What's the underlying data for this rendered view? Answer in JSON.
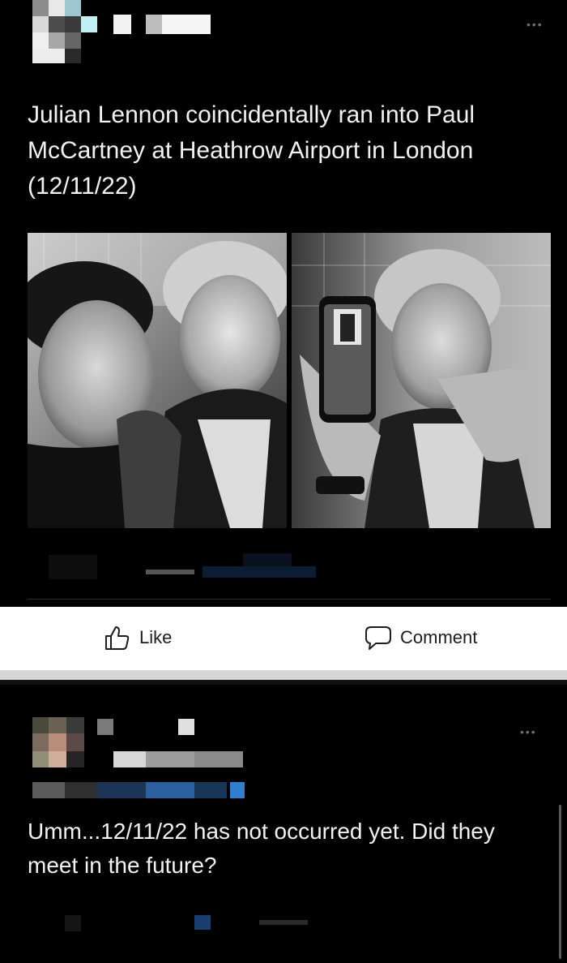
{
  "post": {
    "text": "Julian Lennon coincidentally ran into Paul McCartney at Heathrow Airport in London (12/11/22)",
    "more_icon": "more-horizontal-icon"
  },
  "photos": [
    {
      "description_icon": "photo-left"
    },
    {
      "description_icon": "photo-right"
    }
  ],
  "actions": {
    "like_label": "Like",
    "comment_label": "Comment",
    "like_icon": "thumbs-up-icon",
    "comment_icon": "speech-bubble-icon"
  },
  "comment": {
    "text": "Umm...12/11/22 has not occurred yet. Did they meet in the future?",
    "more_icon": "more-horizontal-icon"
  },
  "colors": {
    "background": "#000000",
    "action_bar": "#ffffff",
    "text": "#f2f2f2",
    "blur_blue": "#2f7fd0"
  }
}
